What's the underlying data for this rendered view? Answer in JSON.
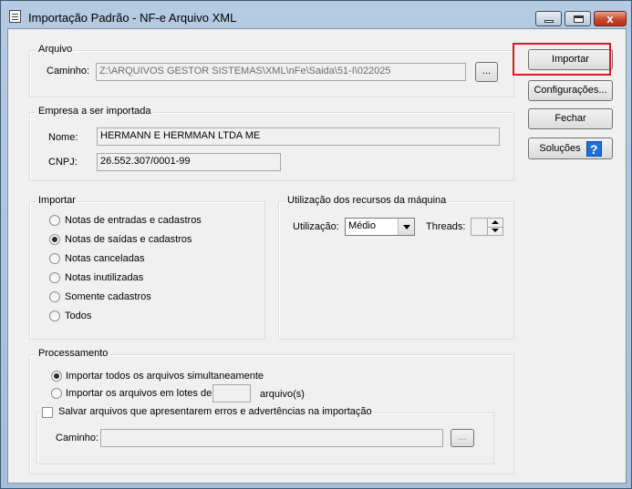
{
  "window": {
    "title": "Importação Padrão - NF-e Arquivo XML",
    "close_label": "x"
  },
  "arquivo": {
    "legend": "Arquivo",
    "caminho_label": "Caminho:",
    "caminho_value": "Z:\\ARQUIVOS GESTOR SISTEMAS\\XML\\nFe\\Saida\\51-I\\022025",
    "browse_label": "..."
  },
  "empresa": {
    "legend": "Empresa a ser importada",
    "nome_label": "Nome:",
    "nome_value": "HERMANN E HERMMAN LTDA ME",
    "cnpj_label": "CNPJ:",
    "cnpj_value": "26.552.307/0001-99"
  },
  "importar": {
    "legend": "Importar",
    "options": [
      {
        "label": "Notas de entradas e cadastros",
        "selected": false
      },
      {
        "label": "Notas de saídas e cadastros",
        "selected": true
      },
      {
        "label": "Notas canceladas",
        "selected": false
      },
      {
        "label": "Notas inutilizadas",
        "selected": false
      },
      {
        "label": "Somente cadastros",
        "selected": false
      },
      {
        "label": "Todos",
        "selected": false
      }
    ]
  },
  "recursos": {
    "legend": "Utilização dos recursos da máquina",
    "utilizacao_label": "Utilização:",
    "utilizacao_value": "Médio",
    "threads_label": "Threads:",
    "threads_value": ""
  },
  "processamento": {
    "legend": "Processamento",
    "opt_todos": "Importar todos os arquivos simultaneamente",
    "opt_lotes": "Importar os arquivos em lotes de:",
    "lotes_value": "",
    "lotes_suffix": "arquivo(s)",
    "salvar_label": "Salvar arquivos que apresentarem erros e advertências na importação",
    "caminho_label": "Caminho:",
    "caminho_value": "",
    "browse_label": "..."
  },
  "buttons": {
    "importar": "Importar",
    "configuracoes": "Configurações...",
    "fechar": "Fechar",
    "solucoes": "Soluções",
    "help_icon": "?"
  },
  "colors": {
    "highlight": "#d81c26",
    "help_icon_bg": "#1e6fd9"
  }
}
